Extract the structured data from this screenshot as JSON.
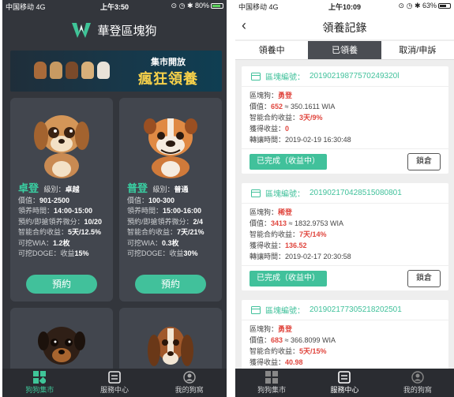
{
  "left": {
    "status": {
      "carrier": "中国移动 4G",
      "time": "上午3:50",
      "right": "⊙ ◷ ✱ 80%"
    },
    "app_title": "華登區塊狗",
    "banner": {
      "line1": "集市開放",
      "line2": "瘋狂領養"
    },
    "cards": [
      {
        "name": "卓登",
        "level_label": "級別：",
        "level": "卓越",
        "rows": [
          {
            "k": "價值：",
            "v": "901-2500"
          },
          {
            "k": "領养時間：",
            "v": "14:00-15:00"
          },
          {
            "k": "預約/即搶領养微分：",
            "v": "10/20"
          },
          {
            "k": "智能合約收益：",
            "v": "5天/12.5%"
          },
          {
            "k": "可挖WIA：",
            "v": "1.2枚"
          },
          {
            "k": "可挖DOGE：收益",
            "v": "15%"
          }
        ],
        "button": "預約"
      },
      {
        "name": "普登",
        "level_label": "級別：",
        "level": "普通",
        "rows": [
          {
            "k": "價值：",
            "v": "100-300"
          },
          {
            "k": "領养時間：",
            "v": "15:00-16:00"
          },
          {
            "k": "預約/即搶領养微分：",
            "v": "2/4"
          },
          {
            "k": "智能合約收益：",
            "v": "7天/21%"
          },
          {
            "k": "可挖WIA：",
            "v": "0.3枚"
          },
          {
            "k": "可挖DOGE：收益",
            "v": "30%"
          }
        ],
        "button": "預約"
      }
    ],
    "tabs": [
      {
        "label": "狗狗集市",
        "icon": "grid-icon"
      },
      {
        "label": "服務中心",
        "icon": "document-icon"
      },
      {
        "label": "我的狗窩",
        "icon": "user-icon"
      }
    ]
  },
  "right": {
    "status": {
      "carrier": "中国移动 4G",
      "time": "上午10:09",
      "right": "⊙ ◷ ✱ 63%"
    },
    "title": "領養記錄",
    "segments": [
      "領養中",
      "已領養",
      "取消/申訴"
    ],
    "records": [
      {
        "id_label": "區塊編號：",
        "id": "20190219877570249320l",
        "dog_label": "區塊狗：",
        "dog": "勇登",
        "value_label": "價值：",
        "value": "652",
        "value_wia": "≈ 350.1611 WIA",
        "yield_label": "智能合約收益：",
        "yield": "3天/9%",
        "earned_label": "獲得收益：",
        "earned": "0",
        "transfer_label": "轉讓時間：",
        "transfer": "2019-02-19 16:30:48",
        "status_btn": "已完成（收益中）",
        "lock_btn": "鎖倉"
      },
      {
        "id_label": "區塊編號：",
        "id": "201902170428515080801",
        "dog_label": "區塊狗：",
        "dog": "稀登",
        "value_label": "價值：",
        "value": "3413",
        "value_wia": "≈ 1832.9753 WIA",
        "yield_label": "智能合約收益：",
        "yield": "7天/14%",
        "earned_label": "獲得收益：",
        "earned": "136.52",
        "transfer_label": "轉讓時間：",
        "transfer": "2019-02-17 20:30:58",
        "status_btn": "已完成（收益中）",
        "lock_btn": "鎖倉"
      },
      {
        "id_label": "區塊編號：",
        "id": "201902177305218202501",
        "dog_label": "區塊狗：",
        "dog": "勇登",
        "value_label": "價值：",
        "value": "683",
        "value_wia": "≈ 366.8099 WIA",
        "yield_label": "智能合約收益：",
        "yield": "5天/15%",
        "earned_label": "獲得收益：",
        "earned": "40.98"
      }
    ],
    "tabs": [
      {
        "label": "狗狗集市",
        "icon": "grid-icon"
      },
      {
        "label": "服務中心",
        "icon": "document-icon"
      },
      {
        "label": "我的狗窩",
        "icon": "user-icon"
      }
    ]
  },
  "colors": {
    "accent": "#41c19b",
    "dark_bg": "#33363c",
    "card_bg": "#42464e",
    "red": "#e0463e"
  }
}
